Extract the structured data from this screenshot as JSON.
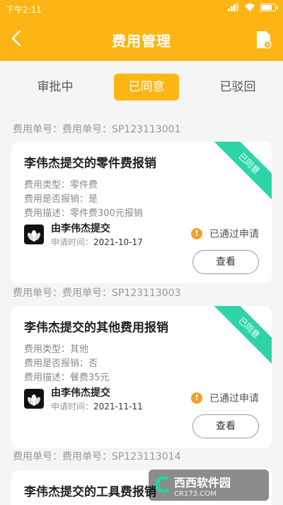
{
  "status_bar": {
    "time": "下午2:11"
  },
  "header": {
    "title": "费用管理"
  },
  "tabs": [
    {
      "label": "审批中"
    },
    {
      "label": "已同意"
    },
    {
      "label": "已驳回"
    }
  ],
  "list": [
    {
      "group_label": "费用单号：费用单号：SP123113001",
      "title": "李伟杰提交的零件费报销",
      "ribbon": "已同意",
      "type_line": "费用类型：零件费",
      "reimburse_line": "费用是否报销：是",
      "desc_line": "费用描述：零件费300元报销",
      "submitter": "由李伟杰提交",
      "time_label": "申请时间：",
      "time_value": "2021-10-17",
      "status": "已通过申请",
      "view_label": "查看"
    },
    {
      "group_label": "费用单号：费用单号：SP123113003",
      "title": "李伟杰提交的其他费用报销",
      "ribbon": "已同意",
      "type_line": "费用类型：其他",
      "reimburse_line": "费用是否报销：否",
      "desc_line": "费用描述：餐费35元",
      "submitter": "由李伟杰提交",
      "time_label": "申请时间：",
      "time_value": "2021-11-11",
      "status": "已通过申请",
      "view_label": "查看"
    },
    {
      "group_label": "费用单号：费用单号：SP123113014",
      "title": "李伟杰提交的工具费报销"
    }
  ],
  "watermark": {
    "name": "西西软件园",
    "url": "CR173.COM"
  },
  "colors": {
    "accent": "#fdb515",
    "ribbon": "#2ed3a8",
    "status_dot": "#f0a22b"
  }
}
